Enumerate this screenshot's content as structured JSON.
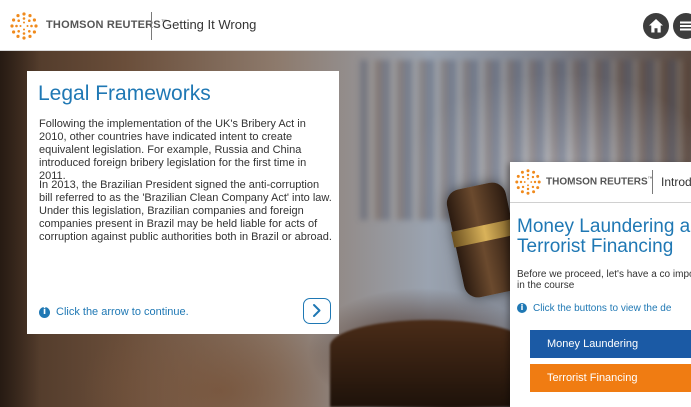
{
  "header": {
    "brand": "THOMSON REUTERS",
    "brand_mark": "™",
    "course_title": "Getting It Wrong",
    "home_icon": "home-icon",
    "menu_icon": "menu-icon"
  },
  "card": {
    "title": "Legal Frameworks",
    "paragraph_1": "Following the implementation of the UK's Bribery Act in 2010, other countries have indicated intent to create equivalent legislation. For example, Russia and China introduced foreign bribery legislation for the first time in 2011.",
    "paragraph_2": "In 2013, the Brazilian President signed the anti-corruption bill referred to as the 'Brazilian Clean Company Act' into law. Under this legislation, Brazilian companies and foreign companies present in Brazil may be held liable for acts of corruption against public authorities both in Brazil or abroad.",
    "hint": "Click the arrow to continue.",
    "next_icon": "chevron-right-icon"
  },
  "overlay": {
    "brand": "THOMSON REUTERS",
    "brand_mark": "™",
    "course_title": "Introd",
    "title": "Money Laundering and Terrorist Financing",
    "text": "Before we proceed, let's have a co important terms used in the course",
    "hint": "Click the buttons to view the de",
    "buttons": [
      {
        "label": "Money Laundering"
      },
      {
        "label": "Terrorist Financing"
      }
    ]
  },
  "colors": {
    "accent_blue": "#1f78b4",
    "button_blue": "#1b5aa5",
    "button_orange": "#f07c12",
    "logo_orange": "#f08a1c"
  }
}
